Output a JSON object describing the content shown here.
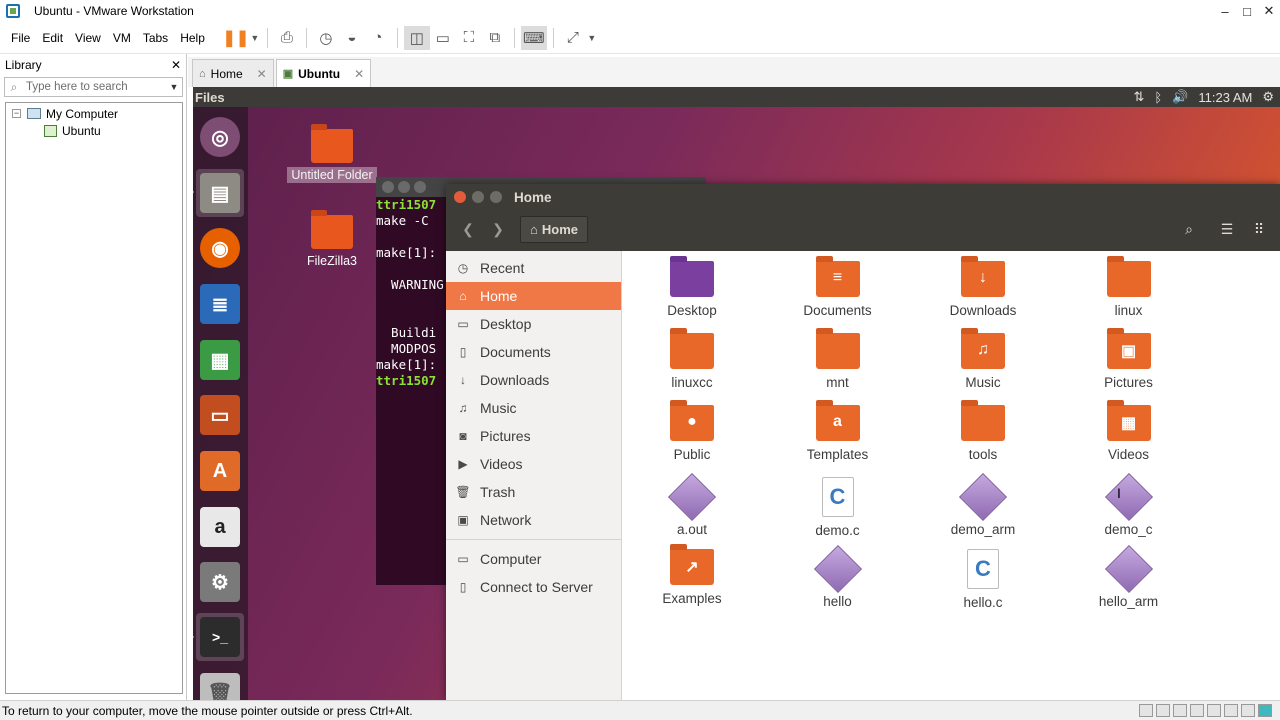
{
  "window": {
    "title": "Ubuntu - VMware Workstation",
    "minimize": "–",
    "maximize": "□",
    "close": "✕"
  },
  "menu": {
    "items": [
      "File",
      "Edit",
      "View",
      "VM",
      "Tabs",
      "Help"
    ]
  },
  "library": {
    "title": "Library",
    "close": "✕",
    "search_placeholder": "Type here to search",
    "tree": {
      "root": "My Computer",
      "child": "Ubuntu"
    }
  },
  "tabs": [
    {
      "label": "Home",
      "close": "✕"
    },
    {
      "label": "Ubuntu",
      "close": "✕"
    }
  ],
  "status": {
    "message": "To return to your computer, move the mouse pointer outside or press Ctrl+Alt."
  },
  "guest": {
    "topbar": {
      "app": "Files",
      "time": "11:23 AM"
    },
    "desktop": [
      {
        "label": "Untitled Folder"
      },
      {
        "label": "FileZilla3"
      }
    ],
    "terminal": {
      "lines": [
        {
          "text": "ttri1507",
          "prompt": true
        },
        {
          "text": "make -C",
          "prompt": false
        },
        {
          "text": "",
          "prompt": false
        },
        {
          "text": "make[1]:",
          "prompt": false
        },
        {
          "text": "",
          "prompt": false
        },
        {
          "text": "  WARNING",
          "prompt": false
        },
        {
          "text": "",
          "prompt": false
        },
        {
          "text": "",
          "prompt": false
        },
        {
          "text": "  Buildi",
          "prompt": false
        },
        {
          "text": "  MODPOS",
          "prompt": false
        },
        {
          "text": "make[1]:",
          "prompt": false
        },
        {
          "text": "ttri1507",
          "prompt": true
        }
      ]
    },
    "files": {
      "window_title": "Home",
      "breadcrumb": "Home",
      "sidebar": [
        {
          "label": "Recent",
          "icon": "◷"
        },
        {
          "label": "Home",
          "icon": "⌂"
        },
        {
          "label": "Desktop",
          "icon": "▭"
        },
        {
          "label": "Documents",
          "icon": "▯"
        },
        {
          "label": "Downloads",
          "icon": "↓"
        },
        {
          "label": "Music",
          "icon": "♫"
        },
        {
          "label": "Pictures",
          "icon": "◙"
        },
        {
          "label": "Videos",
          "icon": "▶"
        },
        {
          "label": "Trash",
          "icon": "🗑"
        },
        {
          "label": "Network",
          "icon": "▣"
        },
        {
          "label": "Computer",
          "icon": "▭"
        },
        {
          "label": "Connect to Server",
          "icon": "▯"
        }
      ],
      "items": [
        {
          "label": "Desktop",
          "kind": "folder-desktop",
          "emblem": ""
        },
        {
          "label": "Documents",
          "kind": "folder",
          "emblem": "≡"
        },
        {
          "label": "Downloads",
          "kind": "folder",
          "emblem": "↓"
        },
        {
          "label": "linux",
          "kind": "folder",
          "emblem": ""
        },
        {
          "label": "linuxcc",
          "kind": "folder",
          "emblem": ""
        },
        {
          "label": "mnt",
          "kind": "folder",
          "emblem": ""
        },
        {
          "label": "Music",
          "kind": "folder",
          "emblem": "♫"
        },
        {
          "label": "Pictures",
          "kind": "folder",
          "emblem": "▣"
        },
        {
          "label": "Public",
          "kind": "folder",
          "emblem": "●"
        },
        {
          "label": "Templates",
          "kind": "folder",
          "emblem": "a"
        },
        {
          "label": "tools",
          "kind": "folder",
          "emblem": ""
        },
        {
          "label": "Videos",
          "kind": "folder",
          "emblem": "▦"
        },
        {
          "label": "a.out",
          "kind": "exec",
          "emblem": ""
        },
        {
          "label": "demo.c",
          "kind": "csource",
          "emblem": "C"
        },
        {
          "label": "demo_arm",
          "kind": "exec",
          "emblem": ""
        },
        {
          "label": "demo_c",
          "kind": "exec",
          "emblem": ""
        },
        {
          "label": "Examples",
          "kind": "folder",
          "emblem": "↗"
        },
        {
          "label": "hello",
          "kind": "exec",
          "emblem": ""
        },
        {
          "label": "hello.c",
          "kind": "csource",
          "emblem": "C"
        },
        {
          "label": "hello_arm",
          "kind": "exec",
          "emblem": ""
        }
      ]
    }
  }
}
